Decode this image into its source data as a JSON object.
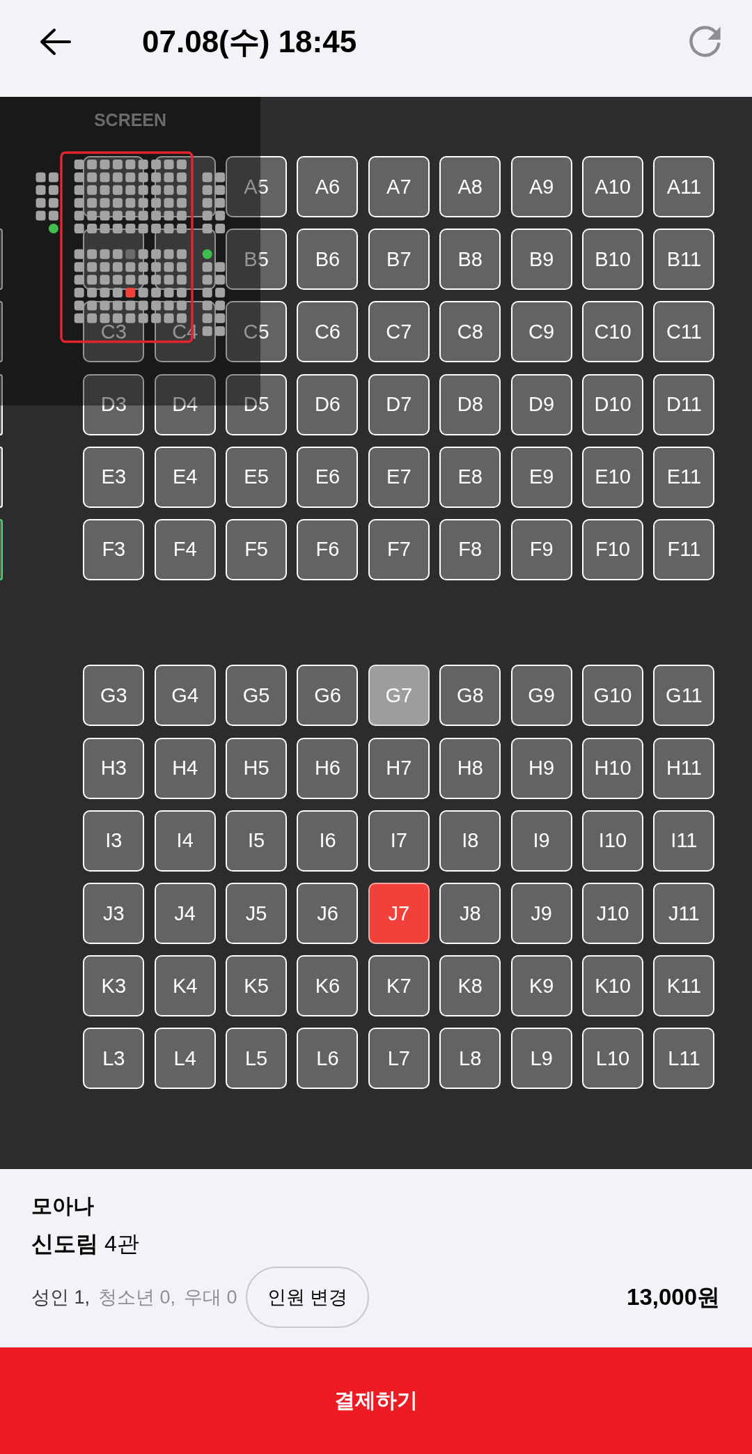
{
  "header": {
    "title": "07.08(수) 18:45"
  },
  "seat_map": {
    "screen_label": "SCREEN",
    "sections": [
      {
        "rows": [
          {
            "seats": [
              {
                "selected": false,
                "sold": false
              },
              {
                "selected": false,
                "sold": false
              },
              {
                "label": "A5",
                "selected": false,
                "sold": false
              },
              {
                "label": "A6",
                "selected": false,
                "sold": false
              },
              {
                "label": "A7",
                "selected": false,
                "sold": false
              },
              {
                "label": "A8",
                "selected": false,
                "sold": false
              },
              {
                "label": "A9",
                "selected": false,
                "sold": false
              },
              {
                "label": "A10",
                "selected": false,
                "sold": false
              },
              {
                "label": "A11",
                "selected": false,
                "sold": false
              }
            ]
          },
          {
            "seats": [
              {
                "selected": false,
                "sold": false
              },
              {
                "selected": false,
                "sold": false
              },
              {
                "label": "B5",
                "selected": false,
                "sold": false
              },
              {
                "label": "B6",
                "selected": false,
                "sold": false
              },
              {
                "label": "B7",
                "selected": false,
                "sold": false
              },
              {
                "label": "B8",
                "selected": false,
                "sold": false
              },
              {
                "label": "B9",
                "selected": false,
                "sold": false
              },
              {
                "label": "B10",
                "selected": false,
                "sold": false
              },
              {
                "label": "B11",
                "selected": false,
                "sold": false
              }
            ]
          },
          {
            "seats": [
              {
                "label": "C3",
                "selected": false,
                "sold": false
              },
              {
                "label": "C4",
                "selected": false,
                "sold": false
              },
              {
                "label": "C5",
                "selected": false,
                "sold": false
              },
              {
                "label": "C6",
                "selected": false,
                "sold": false
              },
              {
                "label": "C7",
                "selected": false,
                "sold": false
              },
              {
                "label": "C8",
                "selected": false,
                "sold": false
              },
              {
                "label": "C9",
                "selected": false,
                "sold": false
              },
              {
                "label": "C10",
                "selected": false,
                "sold": false
              },
              {
                "label": "C11",
                "selected": false,
                "sold": false
              }
            ]
          },
          {
            "seats": [
              {
                "label": "D3",
                "selected": false,
                "sold": false
              },
              {
                "label": "D4",
                "selected": false,
                "sold": false
              },
              {
                "label": "D5",
                "selected": false,
                "sold": false
              },
              {
                "label": "D6",
                "selected": false,
                "sold": false
              },
              {
                "label": "D7",
                "selected": false,
                "sold": false
              },
              {
                "label": "D8",
                "selected": false,
                "sold": false
              },
              {
                "label": "D9",
                "selected": false,
                "sold": false
              },
              {
                "label": "D10",
                "selected": false,
                "sold": false
              },
              {
                "label": "D11",
                "selected": false,
                "sold": false
              }
            ]
          },
          {
            "seats": [
              {
                "label": "E3",
                "selected": false,
                "sold": false
              },
              {
                "label": "E4",
                "selected": false,
                "sold": false
              },
              {
                "label": "E5",
                "selected": false,
                "sold": false
              },
              {
                "label": "E6",
                "selected": false,
                "sold": false
              },
              {
                "label": "E7",
                "selected": false,
                "sold": false
              },
              {
                "label": "E8",
                "selected": false,
                "sold": false
              },
              {
                "label": "E9",
                "selected": false,
                "sold": false
              },
              {
                "label": "E10",
                "selected": false,
                "sold": false
              },
              {
                "label": "E11",
                "selected": false,
                "sold": false
              }
            ]
          },
          {
            "seats": [
              {
                "label": "F3",
                "selected": false,
                "sold": false
              },
              {
                "label": "F4",
                "selected": false,
                "sold": false
              },
              {
                "label": "F5",
                "selected": false,
                "sold": false
              },
              {
                "label": "F6",
                "selected": false,
                "sold": false
              },
              {
                "label": "F7",
                "selected": false,
                "sold": false
              },
              {
                "label": "F8",
                "selected": false,
                "sold": false
              },
              {
                "label": "F9",
                "selected": false,
                "sold": false
              },
              {
                "label": "F10",
                "selected": false,
                "sold": false
              },
              {
                "label": "F11",
                "selected": false,
                "sold": false
              }
            ]
          }
        ]
      },
      {
        "rows": [
          {
            "seats": [
              {
                "label": "G3",
                "selected": false,
                "sold": false
              },
              {
                "label": "G4",
                "selected": false,
                "sold": false
              },
              {
                "label": "G5",
                "selected": false,
                "sold": false
              },
              {
                "label": "G6",
                "selected": false,
                "sold": false
              },
              {
                "label": "G7",
                "selected": false,
                "sold": true
              },
              {
                "label": "G8",
                "selected": false,
                "sold": false
              },
              {
                "label": "G9",
                "selected": false,
                "sold": false
              },
              {
                "label": "G10",
                "selected": false,
                "sold": false
              },
              {
                "label": "G11",
                "selected": false,
                "sold": false
              }
            ]
          },
          {
            "seats": [
              {
                "label": "H3",
                "selected": false,
                "sold": false
              },
              {
                "label": "H4",
                "selected": false,
                "sold": false
              },
              {
                "label": "H5",
                "selected": false,
                "sold": false
              },
              {
                "label": "H6",
                "selected": false,
                "sold": false
              },
              {
                "label": "H7",
                "selected": false,
                "sold": false
              },
              {
                "label": "H8",
                "selected": false,
                "sold": false
              },
              {
                "label": "H9",
                "selected": false,
                "sold": false
              },
              {
                "label": "H10",
                "selected": false,
                "sold": false
              },
              {
                "label": "H11",
                "selected": false,
                "sold": false
              }
            ]
          },
          {
            "seats": [
              {
                "label": "I3",
                "selected": false,
                "sold": false
              },
              {
                "label": "I4",
                "selected": false,
                "sold": false
              },
              {
                "label": "I5",
                "selected": false,
                "sold": false
              },
              {
                "label": "I6",
                "selected": false,
                "sold": false
              },
              {
                "label": "I7",
                "selected": false,
                "sold": false
              },
              {
                "label": "I8",
                "selected": false,
                "sold": false
              },
              {
                "label": "I9",
                "selected": false,
                "sold": false
              },
              {
                "label": "I10",
                "selected": false,
                "sold": false
              },
              {
                "label": "I11",
                "selected": false,
                "sold": false
              }
            ]
          },
          {
            "seats": [
              {
                "label": "J3",
                "selected": false,
                "sold": false
              },
              {
                "label": "J4",
                "selected": false,
                "sold": false
              },
              {
                "label": "J5",
                "selected": false,
                "sold": false
              },
              {
                "label": "J6",
                "selected": false,
                "sold": false
              },
              {
                "label": "J7",
                "selected": true,
                "sold": false
              },
              {
                "label": "J8",
                "selected": false,
                "sold": false
              },
              {
                "label": "J9",
                "selected": false,
                "sold": false
              },
              {
                "label": "J10",
                "selected": false,
                "sold": false
              },
              {
                "label": "J11",
                "selected": false,
                "sold": false
              }
            ]
          },
          {
            "seats": [
              {
                "label": "K3",
                "selected": false,
                "sold": false
              },
              {
                "label": "K4",
                "selected": false,
                "sold": false
              },
              {
                "label": "K5",
                "selected": false,
                "sold": false
              },
              {
                "label": "K6",
                "selected": false,
                "sold": false
              },
              {
                "label": "K7",
                "selected": false,
                "sold": false
              },
              {
                "label": "K8",
                "selected": false,
                "sold": false
              },
              {
                "label": "K9",
                "selected": false,
                "sold": false
              },
              {
                "label": "K10",
                "selected": false,
                "sold": false
              },
              {
                "label": "K11",
                "selected": false,
                "sold": false
              }
            ]
          },
          {
            "seats": [
              {
                "label": "L3",
                "selected": false,
                "sold": false
              },
              {
                "label": "L4",
                "selected": false,
                "sold": false
              },
              {
                "label": "L5",
                "selected": false,
                "sold": false
              },
              {
                "label": "L6",
                "selected": false,
                "sold": false
              },
              {
                "label": "L7",
                "selected": false,
                "sold": false
              },
              {
                "label": "L8",
                "selected": false,
                "sold": false
              },
              {
                "label": "L9",
                "selected": false,
                "sold": false
              },
              {
                "label": "L10",
                "selected": false,
                "sold": false
              },
              {
                "label": "L11",
                "selected": false,
                "sold": false
              }
            ]
          }
        ]
      }
    ],
    "side_blocks": {
      "left": [
        {
          "cells": [
            {
              "kind": "empty"
            },
            {
              "kind": "seat"
            },
            {
              "kind": "seat"
            },
            {
              "kind": "seat"
            },
            {
              "kind": "seat"
            }
          ]
        },
        {
          "cells": [
            {
              "kind": "empty"
            },
            {
              "kind": "seat"
            },
            {
              "kind": "seat"
            },
            {
              "kind": "seat"
            },
            {
              "kind": "seat"
            },
            {
              "kind": "special"
            }
          ]
        }
      ],
      "right": [
        {
          "cells": [
            {
              "kind": "empty"
            },
            {
              "kind": "seat"
            },
            {
              "kind": "seat"
            },
            {
              "kind": "seat"
            },
            {
              "kind": "seat"
            },
            {
              "kind": "seat"
            },
            {
              "kind": "special"
            },
            {
              "kind": "seat"
            },
            {
              "kind": "seat"
            },
            {
              "kind": "seat"
            },
            {
              "kind": "seat"
            },
            {
              "kind": "seat"
            },
            {
              "kind": "seat"
            }
          ]
        },
        {
          "cells": [
            {
              "kind": "empty"
            },
            {
              "kind": "seat"
            },
            {
              "kind": "seat"
            },
            {
              "kind": "seat"
            },
            {
              "kind": "seat"
            },
            {
              "kind": "seat"
            },
            {
              "kind": "empty"
            },
            {
              "kind": "seat"
            },
            {
              "kind": "seat"
            },
            {
              "kind": "seat"
            },
            {
              "kind": "seat"
            },
            {
              "kind": "seat"
            },
            {
              "kind": "seat"
            }
          ]
        }
      ]
    }
  },
  "summary": {
    "movie": "모아나",
    "theater": "**신도림** 4관",
    "tickets": [
      {
        "text": "성인 1,",
        "dimmed": false
      },
      {
        "text": "청소년 0,",
        "dimmed": true
      },
      {
        "text": "우대 0",
        "dimmed": true
      }
    ],
    "change_button": "인원 변경",
    "price": "13,000원"
  },
  "pay_button": "결제하기"
}
